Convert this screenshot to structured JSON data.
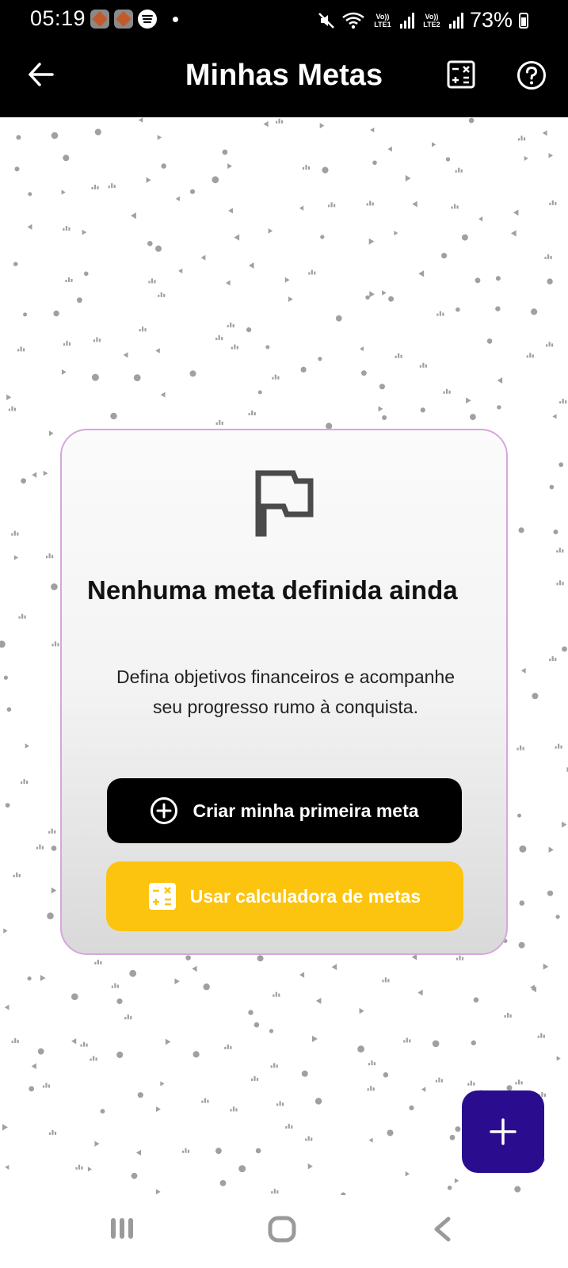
{
  "status_bar": {
    "time": "05:19",
    "sim1_label": "Vo)) LTE1",
    "sim2_label": "Vo)) LTE2",
    "battery_text": "73%",
    "icons": [
      "app-notification-icon",
      "app-notification-icon",
      "spotify-icon",
      "notification-dot-icon",
      "mute-icon",
      "wifi-icon",
      "signal-icon",
      "signal-icon",
      "battery-icon"
    ]
  },
  "app_bar": {
    "title": "Minhas Metas",
    "back_icon": "arrow-left-icon",
    "calculator_icon": "calculator-icon",
    "help_icon": "help-circle-icon"
  },
  "empty_state": {
    "icon": "flag-icon",
    "title": "Nenhuma meta definida ainda",
    "description": "Defina objetivos financeiros e acompanhe seu progresso rumo à conquista.",
    "primary_button_label": "Criar minha primeira meta",
    "primary_button_icon": "plus-circle-icon",
    "secondary_button_label": "Usar calculadora de metas",
    "secondary_button_icon": "calculator-icon"
  },
  "fab": {
    "icon": "plus-icon"
  },
  "navigation_bar": {
    "icons": [
      "recents-icon",
      "home-icon",
      "back-icon"
    ]
  },
  "colors": {
    "header_background": "#000000",
    "card_border": "#d6a6dc",
    "primary_button": "#000000",
    "secondary_button": "#fcc40e",
    "fab_background": "#2a0d8f",
    "pattern_marks": "#a0a0a0"
  }
}
